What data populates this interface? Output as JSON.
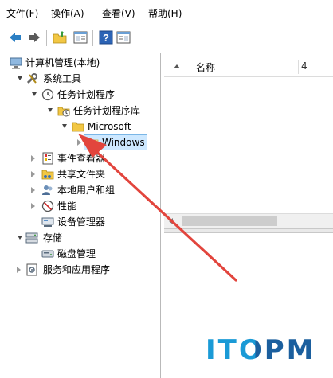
{
  "menubar": {
    "items": [
      {
        "label": "文件(F)"
      },
      {
        "label": "操作(A)"
      },
      {
        "label": "查看(V)"
      },
      {
        "label": "帮助(H)"
      }
    ]
  },
  "tree": {
    "root": "计算机管理(本地)",
    "system_tools": "系统工具",
    "task_scheduler": "任务计划程序",
    "task_library": "任务计划程序库",
    "microsoft": "Microsoft",
    "windows": "Windows",
    "event_viewer": "事件查看器",
    "shared_folders": "共享文件夹",
    "local_users": "本地用户和组",
    "performance": "性能",
    "device_manager": "设备管理器",
    "storage": "存储",
    "disk_management": "磁盘管理",
    "services_apps": "服务和应用程序"
  },
  "list": {
    "col_name": "名称",
    "col_2": "4"
  },
  "watermark": {
    "text": "ITOPM",
    "color_blue": "#1a9ad6",
    "color_dark": "#1b5f9e"
  },
  "colors": {
    "selection": "#cde8ff",
    "arrow": "#e2453d",
    "folder": "#f2c744"
  }
}
